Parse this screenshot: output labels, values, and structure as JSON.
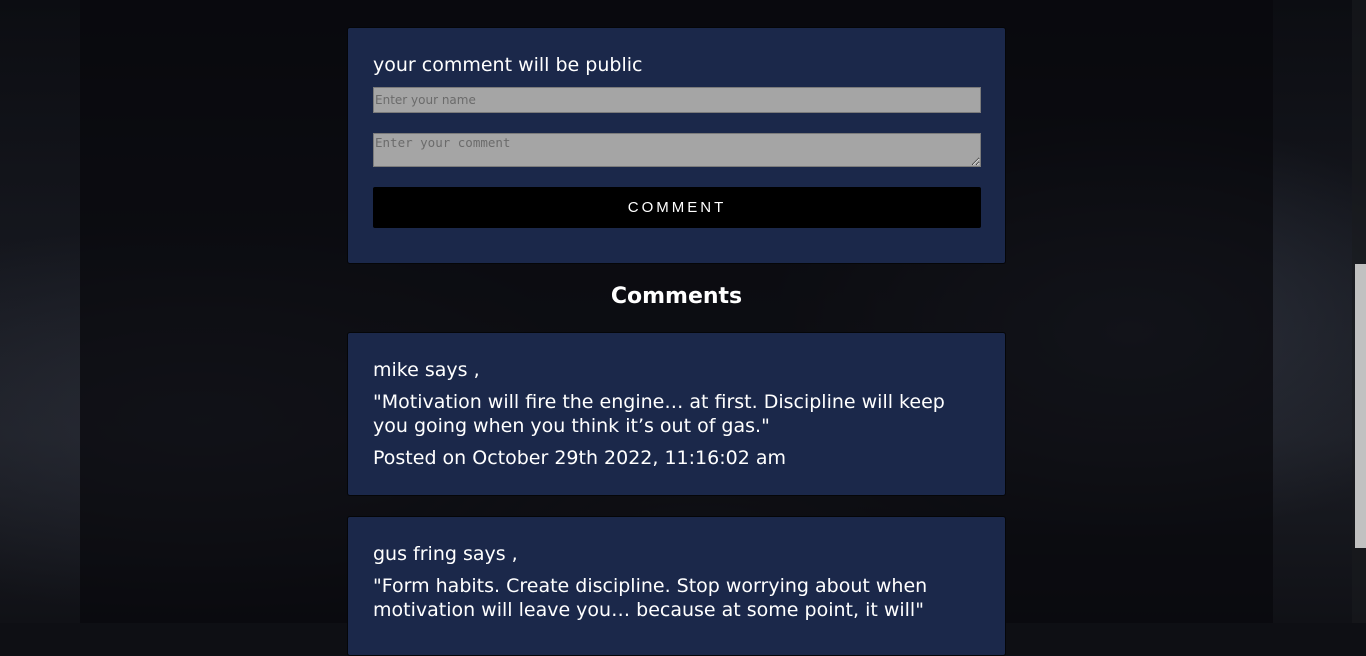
{
  "form": {
    "heading": "your comment will be public",
    "name_placeholder": "Enter your name",
    "comment_placeholder": "Enter your comment",
    "submit_label": "COMMENT"
  },
  "comments_section": {
    "title": "Comments",
    "items": [
      {
        "author_line": "mike says ,",
        "text": "\"Motivation will fire the engine… at first. Discipline will keep you going when you think it’s out of gas.\"",
        "posted": "Posted on October 29th 2022, 11:16:02 am"
      },
      {
        "author_line": "gus fring says ,",
        "text": "\"Form habits. Create discipline. Stop worrying about when motivation will leave you… because at some point, it will\""
      }
    ]
  },
  "colors": {
    "card_background": "#1b284a",
    "input_background": "#a5a5a5",
    "button_background": "#000000",
    "page_background": "#0e0f14"
  }
}
